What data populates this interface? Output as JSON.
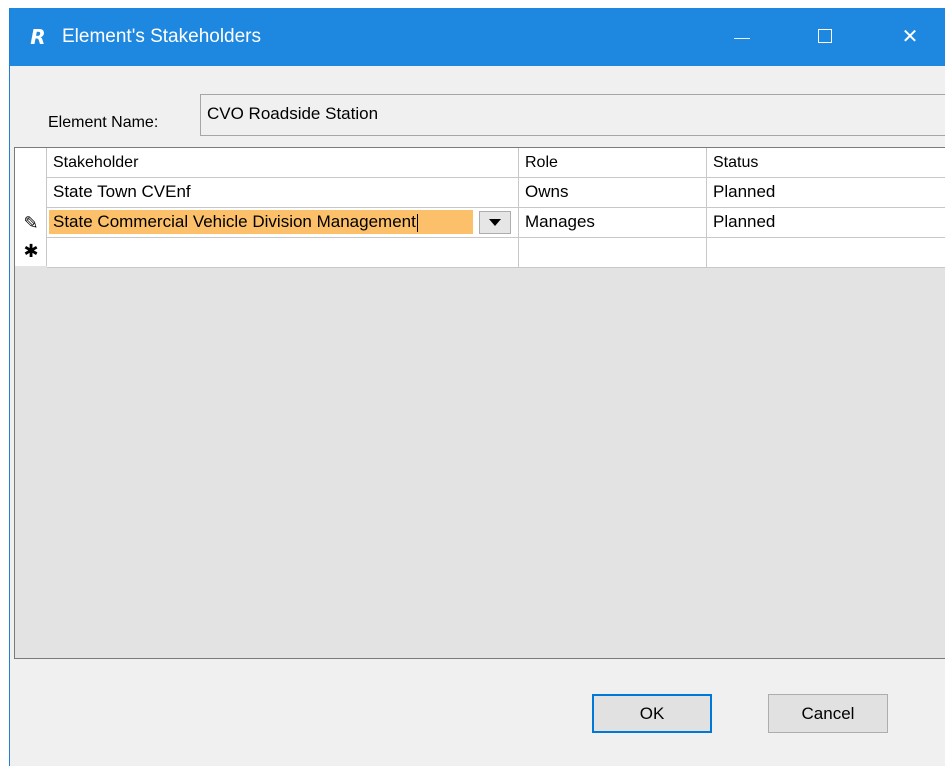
{
  "window": {
    "title": "Element's Stakeholders",
    "app_icon_glyph": "R",
    "icons": [
      "app-logo-icon",
      "minimize-icon",
      "maximize-icon",
      "close-icon"
    ],
    "close_glyph": "✕"
  },
  "element_name": {
    "label": "Element Name:",
    "value": "CVO Roadside Station"
  },
  "grid": {
    "columns": [
      "Stakeholder",
      "Role",
      "Status"
    ],
    "rows": [
      {
        "stakeholder": "State Town CVEnf",
        "role": "Owns",
        "status": "Planned"
      },
      {
        "stakeholder": "State Commercial Vehicle Division Management",
        "role": "Manages",
        "status": "Planned"
      }
    ],
    "editing_indicator": "✎",
    "new_row_indicator": "✱"
  },
  "buttons": {
    "ok": "OK",
    "cancel": "Cancel"
  },
  "colors": {
    "titlebar": "#1e88e0",
    "edit_highlight": "#fbc069",
    "ok_border": "#0078d7"
  }
}
